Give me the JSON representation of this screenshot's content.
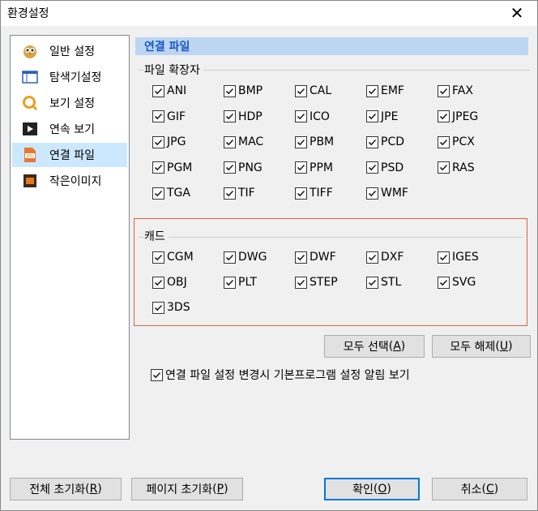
{
  "window": {
    "title": "환경설정",
    "close_label": "✕"
  },
  "sidebar": {
    "items": [
      {
        "label": "일반 설정"
      },
      {
        "label": "탐색기설정"
      },
      {
        "label": "보기 설정"
      },
      {
        "label": "연속 보기"
      },
      {
        "label": "연결 파일"
      },
      {
        "label": "작은이미지"
      }
    ]
  },
  "panel": {
    "header": "연결 파일",
    "ext_group": "파일 확장자",
    "extensions": [
      "ANI",
      "BMP",
      "CAL",
      "EMF",
      "FAX",
      "GIF",
      "HDP",
      "ICO",
      "JPE",
      "JPEG",
      "JPG",
      "MAC",
      "PBM",
      "PCD",
      "PCX",
      "PGM",
      "PNG",
      "PPM",
      "PSD",
      "RAS",
      "TGA",
      "TIF",
      "TIFF",
      "WMF"
    ],
    "cad_group": "캐드",
    "cad_extensions": [
      "CGM",
      "DWG",
      "DWF",
      "DXF",
      "IGES",
      "OBJ",
      "PLT",
      "STEP",
      "STL",
      "SVG",
      "3DS"
    ],
    "select_all": "모두 선택",
    "select_all_key": "A",
    "deselect_all": "모두 해제",
    "deselect_all_key": "U",
    "notify_label": "연결 파일 설정 변경시 기본프로그램 설정 알림 보기"
  },
  "footer": {
    "reset_all": "전체 초기화",
    "reset_all_key": "R",
    "reset_page": "페이지 초기화",
    "reset_page_key": "P",
    "ok": "확인",
    "ok_key": "O",
    "cancel": "취소",
    "cancel_key": "C"
  }
}
